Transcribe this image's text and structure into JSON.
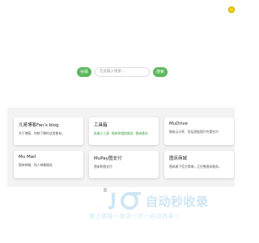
{
  "search": {
    "engine_label": "谷歌",
    "placeholder": "在此输入搜索…",
    "search_label": "搜索"
  },
  "cards": [
    {
      "title": "凡哥博客Fan's blog",
      "desc": "关于博客，你想了解的这里都有。"
    },
    {
      "title": "工具箱",
      "links": [
        "批量小工具",
        "图床和相册服务",
        "图床备份"
      ]
    },
    {
      "title": "MuDrive",
      "desc": "图床云分享、包括直链图片托管在内"
    },
    {
      "title": "Mu Mail",
      "desc": "图床邮箱、私人邮箱服务"
    },
    {
      "title": "MuPay图支付",
      "desc": "图床和图支付"
    },
    {
      "title": "图床商城",
      "desc": "图床旗下官方商城，正在售图床服务。"
    }
  ],
  "watermark": {
    "title": "自动秒收录",
    "subtitle": "做上链接一来访一次一自动收录一"
  },
  "colors": {
    "accent": "#5cb85c",
    "panel_bg": "#f3f3f3",
    "theme_dot": "#f2d21b",
    "watermark": "#cfe6f4"
  }
}
